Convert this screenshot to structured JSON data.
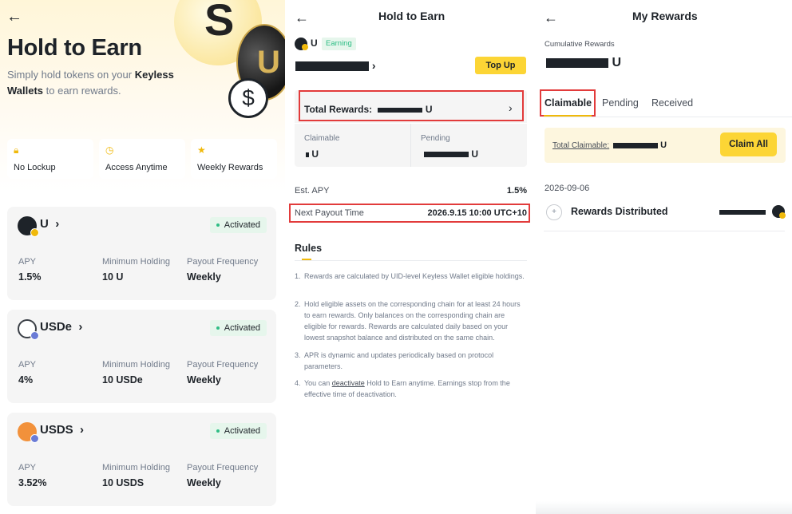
{
  "screen1": {
    "title": "Hold to Earn",
    "desc_pre": "Simply hold tokens on your ",
    "desc_bold": "Keyless Wallets",
    "desc_post": " to earn rewards.",
    "features": [
      {
        "icon": "lock-icon",
        "label": "No Lockup"
      },
      {
        "icon": "clock-icon",
        "label": "Access Anytime"
      },
      {
        "icon": "gift-hand-icon",
        "label": "Weekly Rewards"
      }
    ],
    "assets": [
      {
        "name": "U",
        "status": "Activated",
        "apy_label": "APY",
        "apy": "1.5%",
        "min_label": "Minimum Holding",
        "min": "10 U",
        "freq_label": "Payout Frequency",
        "freq": "Weekly",
        "color": "#1e2329",
        "badge_color": "#f0b90b"
      },
      {
        "name": "USDe",
        "status": "Activated",
        "apy_label": "APY",
        "apy": "4%",
        "min_label": "Minimum Holding",
        "min": "10 USDe",
        "freq_label": "Payout Frequency",
        "freq": "Weekly",
        "color": "#3a3f46",
        "badge_color": "#6a7bd6"
      },
      {
        "name": "USDS",
        "status": "Activated",
        "apy_label": "APY",
        "apy": "3.52%",
        "min_label": "Minimum Holding",
        "min": "10 USDS",
        "freq_label": "Payout Frequency",
        "freq": "Weekly",
        "color": "#f2913b",
        "badge_color": "#6a7bd6"
      }
    ]
  },
  "screen2": {
    "title": "Hold to Earn",
    "token": "U",
    "earning_badge": "Earning",
    "topup": "Top Up",
    "total_rewards_label": "Total Rewards:",
    "total_rewards_unit": "U",
    "claimable_label": "Claimable",
    "claimable_unit": "U",
    "pending_label": "Pending",
    "pending_unit": "U",
    "apy_label": "Est. APY",
    "apy_value": "1.5%",
    "payout_label": "Next Payout Time",
    "payout_value": "2026.9.15 10:00 UTC+10",
    "rules_title": "Rules",
    "rules": [
      {
        "n": "1.",
        "text": "Rewards are calculated by UID-level Keyless Wallet eligible holdings."
      },
      {
        "n": "2.",
        "text": "Hold eligible assets on the corresponding chain for at least 24 hours to earn rewards. Only balances on the corresponding chain are eligible for rewards. Rewards are calculated daily based on your lowest snapshot balance and distributed on the same chain."
      },
      {
        "n": "3.",
        "text": "APR is dynamic and updates periodically based on protocol parameters."
      },
      {
        "n": "4.",
        "pre": "You can ",
        "link": "deactivate",
        "post": " Hold to Earn anytime. Earnings stop from the effective time of deactivation."
      }
    ]
  },
  "screen3": {
    "title": "My Rewards",
    "cumulative_label": "Cumulative Rewards",
    "cumulative_unit": "U",
    "tabs": [
      "Claimable",
      "Pending",
      "Received"
    ],
    "total_claimable_label": "Total Claimable:",
    "total_claimable_unit": "U",
    "claim_all": "Claim All",
    "date": "2026-09-06",
    "row_label": "Rewards Distributed"
  },
  "colors": {
    "accent": "#fcd535",
    "activated": "#2ebd85",
    "highlight": "#e23b3b"
  }
}
